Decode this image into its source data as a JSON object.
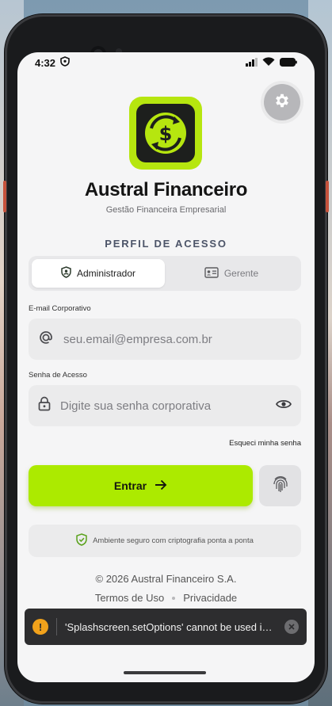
{
  "status_bar": {
    "time": "4:32"
  },
  "app": {
    "title": "Austral Financeiro",
    "subtitle": "Gestão Financeira Empresarial"
  },
  "profile": {
    "heading": "PERFIL DE ACESSO",
    "tabs": [
      {
        "label": "Administrador",
        "icon": "shield-person-icon",
        "selected": true
      },
      {
        "label": "Gerente",
        "icon": "id-card-icon",
        "selected": false
      }
    ]
  },
  "form": {
    "email_label": "E-mail Corporativo",
    "email_placeholder": "seu.email@empresa.com.br",
    "password_label": "Senha de Acesso",
    "password_placeholder": "Digite sua senha corporativa",
    "forgot_label": "Esqueci minha senha",
    "submit_label": "Entrar"
  },
  "security_note": "Ambiente seguro com criptografia ponta a ponta",
  "footer": {
    "copyright": "© 2026 Austral Financeiro S.A.",
    "terms": "Termos de Uso",
    "privacy": "Privacidade"
  },
  "toast": {
    "message": "'Splashscreen.setOptions' cannot be used in Expo Go"
  },
  "colors": {
    "accent": "#acea00",
    "logo_bg": "#b6e60f",
    "warning": "#f2a21b",
    "heading": "#4c5468"
  }
}
